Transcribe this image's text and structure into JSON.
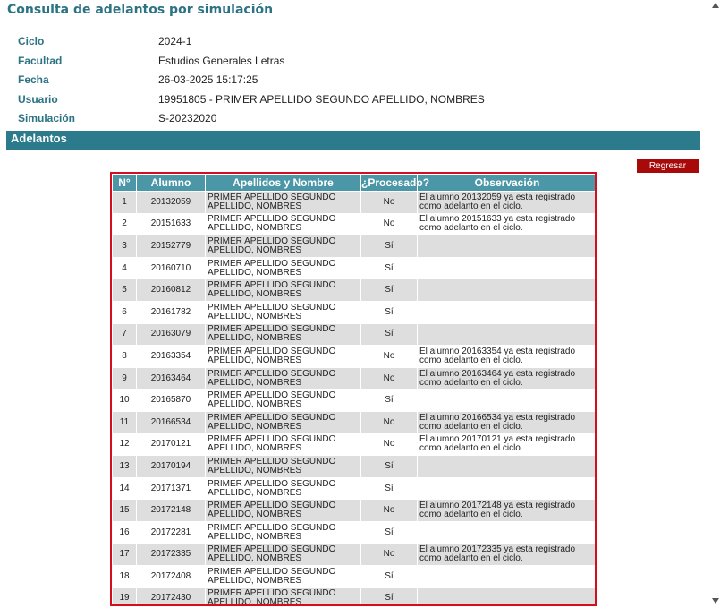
{
  "page_title": "Consulta de adelantos por simulación",
  "info": [
    {
      "label": "Ciclo",
      "value": "2024-1"
    },
    {
      "label": "Facultad",
      "value": "Estudios Generales Letras"
    },
    {
      "label": "Fecha",
      "value": "26-03-2025 15:17:25"
    },
    {
      "label": "Usuario",
      "value": "19951805 - PRIMER APELLIDO SEGUNDO APELLIDO, NOMBRES"
    },
    {
      "label": "Simulación",
      "value": "S-20232020"
    }
  ],
  "section_title": "Adelantos",
  "regresar_label": "Regresar",
  "table": {
    "headers": [
      "N°",
      "Alumno",
      "Apellidos y Nombre",
      "¿Procesado?",
      "Observación"
    ],
    "rows": [
      {
        "n": "1",
        "alumno": "20132059",
        "nombre": "PRIMER APELLIDO SEGUNDO APELLIDO, NOMBRES",
        "procesado": "No",
        "obs": "El alumno 20132059 ya esta registrado como adelanto en el ciclo."
      },
      {
        "n": "2",
        "alumno": "20151633",
        "nombre": "PRIMER APELLIDO SEGUNDO APELLIDO, NOMBRES",
        "procesado": "No",
        "obs": "El alumno 20151633 ya esta registrado como adelanto en el ciclo."
      },
      {
        "n": "3",
        "alumno": "20152779",
        "nombre": "PRIMER APELLIDO SEGUNDO APELLIDO, NOMBRES",
        "procesado": "Sí",
        "obs": ""
      },
      {
        "n": "4",
        "alumno": "20160710",
        "nombre": "PRIMER APELLIDO SEGUNDO APELLIDO, NOMBRES",
        "procesado": "Sí",
        "obs": ""
      },
      {
        "n": "5",
        "alumno": "20160812",
        "nombre": "PRIMER APELLIDO SEGUNDO APELLIDO, NOMBRES",
        "procesado": "Sí",
        "obs": ""
      },
      {
        "n": "6",
        "alumno": "20161782",
        "nombre": "PRIMER APELLIDO SEGUNDO APELLIDO, NOMBRES",
        "procesado": "Sí",
        "obs": ""
      },
      {
        "n": "7",
        "alumno": "20163079",
        "nombre": "PRIMER APELLIDO SEGUNDO APELLIDO, NOMBRES",
        "procesado": "Sí",
        "obs": ""
      },
      {
        "n": "8",
        "alumno": "20163354",
        "nombre": "PRIMER APELLIDO SEGUNDO APELLIDO, NOMBRES",
        "procesado": "No",
        "obs": "El alumno 20163354 ya esta registrado como adelanto en el ciclo."
      },
      {
        "n": "9",
        "alumno": "20163464",
        "nombre": "PRIMER APELLIDO SEGUNDO APELLIDO, NOMBRES",
        "procesado": "No",
        "obs": "El alumno 20163464 ya esta registrado como adelanto en el ciclo."
      },
      {
        "n": "10",
        "alumno": "20165870",
        "nombre": "PRIMER APELLIDO SEGUNDO APELLIDO, NOMBRES",
        "procesado": "Sí",
        "obs": ""
      },
      {
        "n": "11",
        "alumno": "20166534",
        "nombre": "PRIMER APELLIDO SEGUNDO APELLIDO, NOMBRES",
        "procesado": "No",
        "obs": "El alumno 20166534 ya esta registrado como adelanto en el ciclo."
      },
      {
        "n": "12",
        "alumno": "20170121",
        "nombre": "PRIMER APELLIDO SEGUNDO APELLIDO, NOMBRES",
        "procesado": "No",
        "obs": "El alumno 20170121 ya esta registrado como adelanto en el ciclo."
      },
      {
        "n": "13",
        "alumno": "20170194",
        "nombre": "PRIMER APELLIDO SEGUNDO APELLIDO, NOMBRES",
        "procesado": "Sí",
        "obs": ""
      },
      {
        "n": "14",
        "alumno": "20171371",
        "nombre": "PRIMER APELLIDO SEGUNDO APELLIDO, NOMBRES",
        "procesado": "Sí",
        "obs": ""
      },
      {
        "n": "15",
        "alumno": "20172148",
        "nombre": "PRIMER APELLIDO SEGUNDO APELLIDO, NOMBRES",
        "procesado": "No",
        "obs": "El alumno 20172148 ya esta registrado como adelanto en el ciclo."
      },
      {
        "n": "16",
        "alumno": "20172281",
        "nombre": "PRIMER APELLIDO SEGUNDO APELLIDO, NOMBRES",
        "procesado": "Sí",
        "obs": ""
      },
      {
        "n": "17",
        "alumno": "20172335",
        "nombre": "PRIMER APELLIDO SEGUNDO APELLIDO, NOMBRES",
        "procesado": "No",
        "obs": "El alumno 20172335 ya esta registrado como adelanto en el ciclo."
      },
      {
        "n": "18",
        "alumno": "20172408",
        "nombre": "PRIMER APELLIDO SEGUNDO APELLIDO, NOMBRES",
        "procesado": "Sí",
        "obs": ""
      },
      {
        "n": "19",
        "alumno": "20172430",
        "nombre": "PRIMER APELLIDO SEGUNDO APELLIDO, NOMBRES",
        "procesado": "Sí",
        "obs": ""
      }
    ]
  }
}
